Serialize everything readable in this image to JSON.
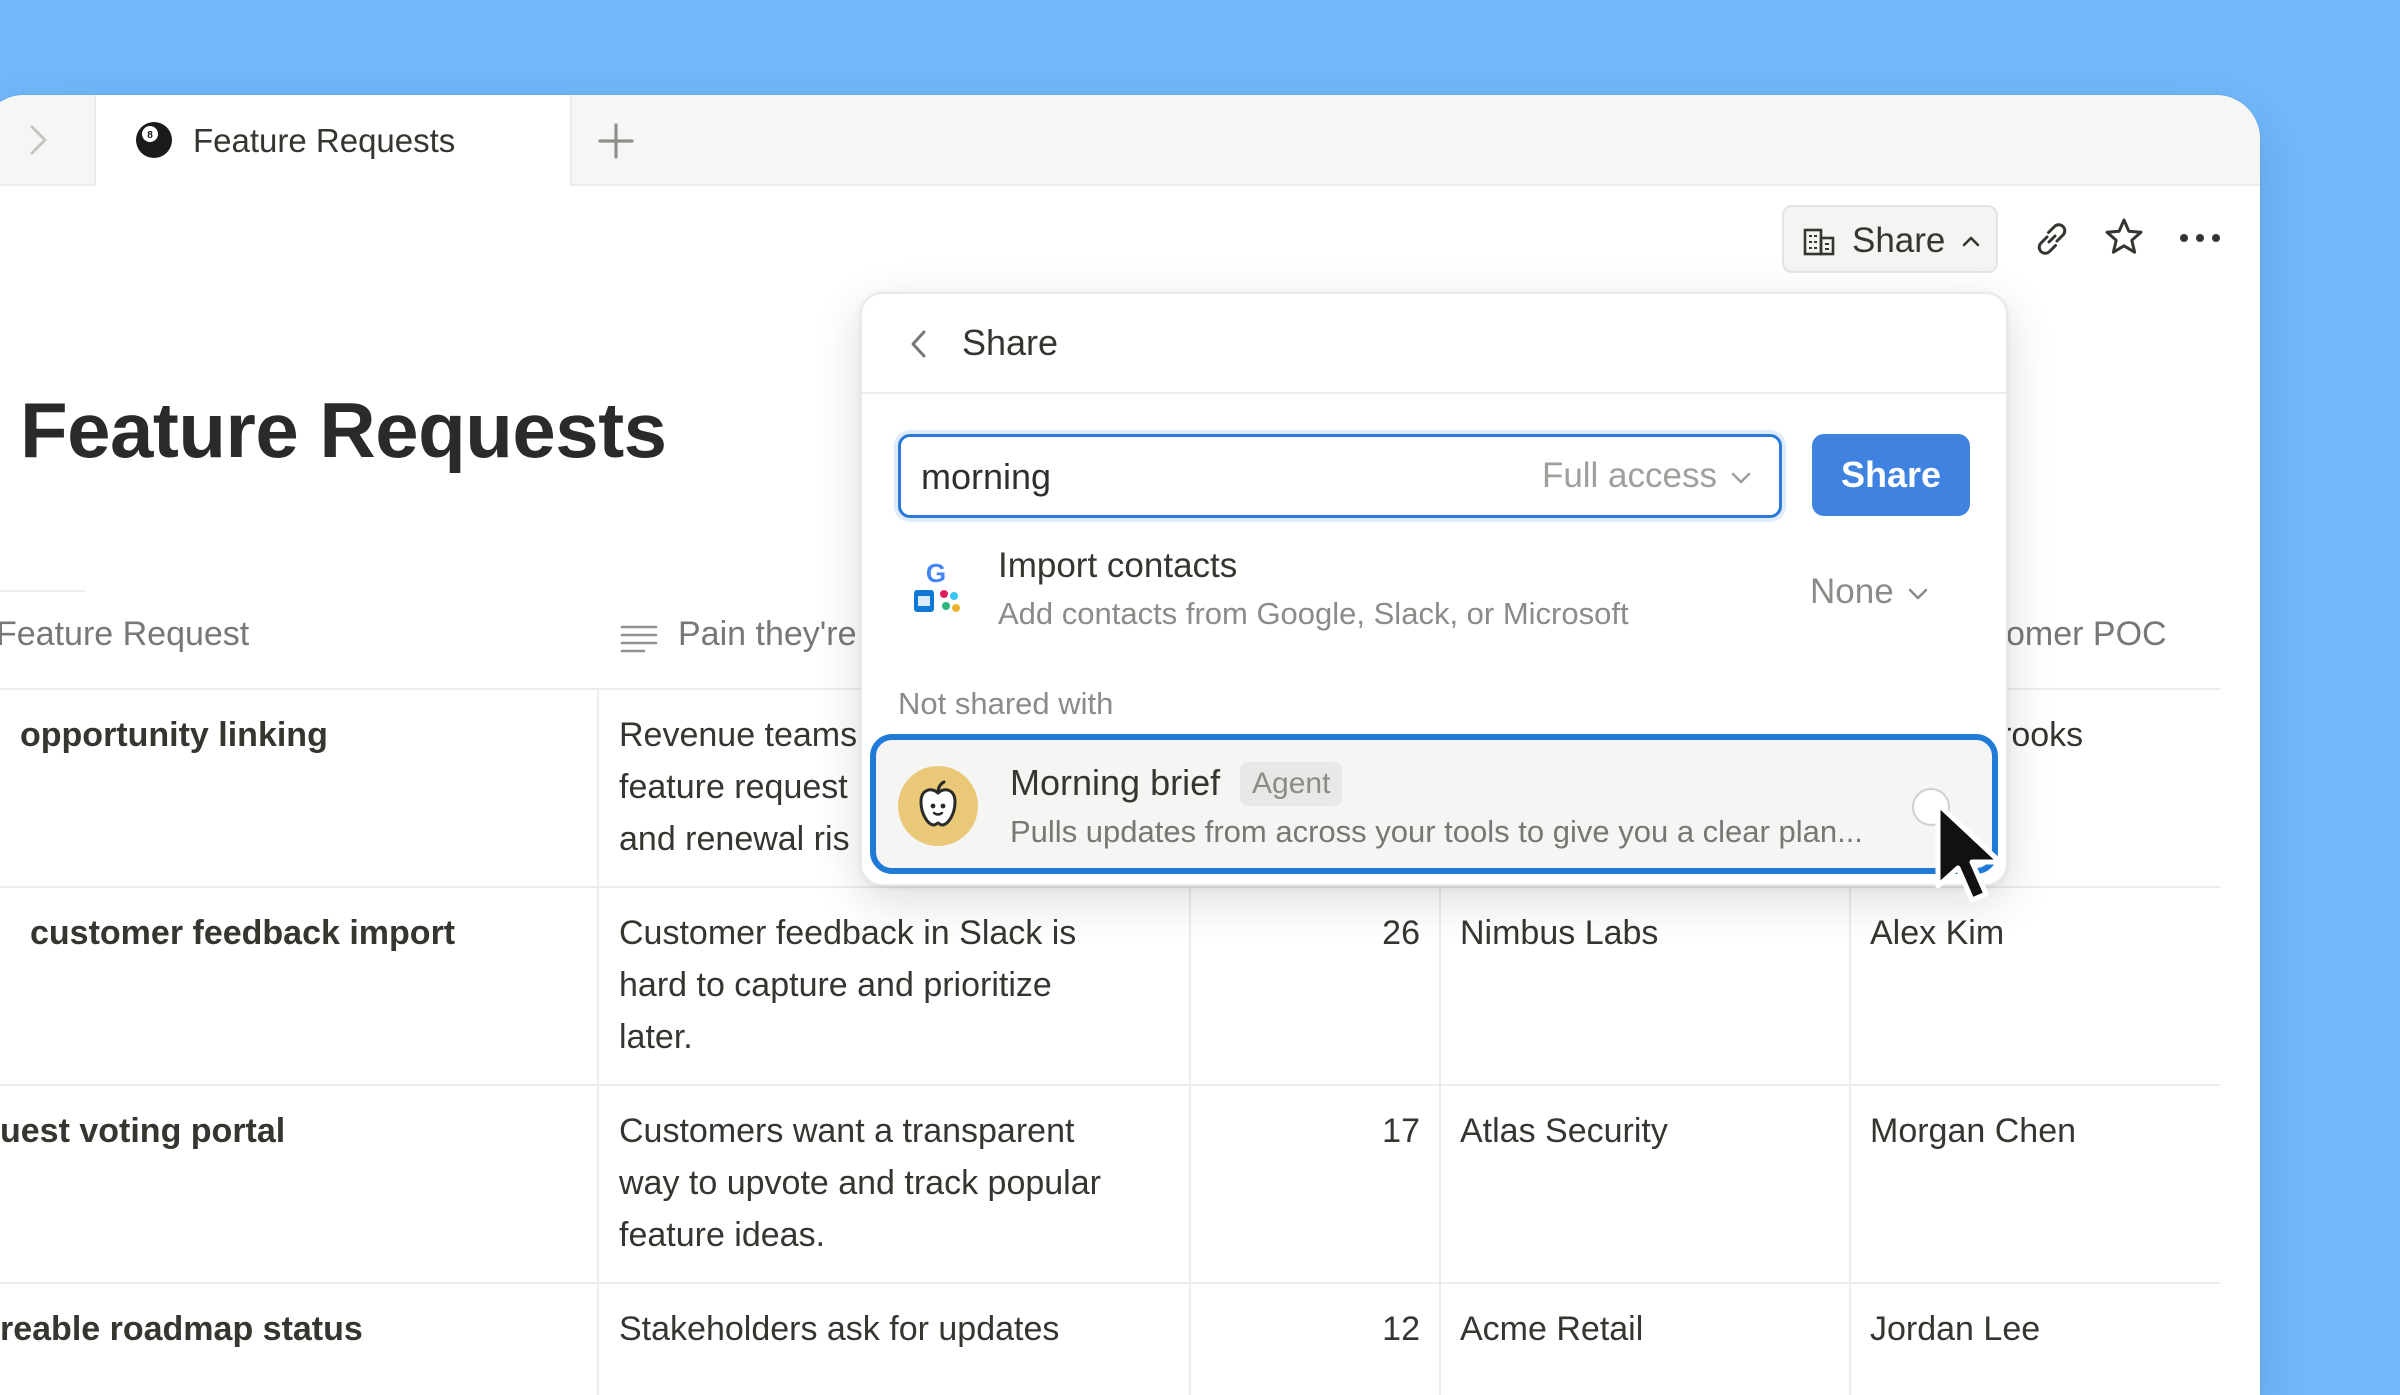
{
  "tab": {
    "title": "Feature Requests"
  },
  "toolbar": {
    "share_label": "Share"
  },
  "page": {
    "title": "Feature Requests"
  },
  "table": {
    "columns": [
      "Feature Request",
      "Pain they're",
      "omer POC"
    ],
    "rows": [
      {
        "feature": "opportunity linking",
        "pain": [
          "Revenue teams",
          "feature request",
          "and renewal ris"
        ],
        "count": "",
        "company": "",
        "poc": "rooks"
      },
      {
        "feature": " customer feedback import",
        "pain": [
          "Customer feedback in Slack is",
          "hard to capture and prioritize",
          "later."
        ],
        "count": "26",
        "company": "Nimbus Labs",
        "poc": "Alex Kim"
      },
      {
        "feature": "uest voting portal",
        "pain": [
          "Customers want a transparent",
          "way to upvote and track popular",
          "feature ideas."
        ],
        "count": "17",
        "company": "Atlas Security",
        "poc": "Morgan Chen"
      },
      {
        "feature": "reable roadmap status",
        "pain": [
          "Stakeholders ask for updates"
        ],
        "count": "12",
        "company": "Acme Retail",
        "poc": "Jordan Lee"
      }
    ]
  },
  "popup": {
    "title": "Share",
    "invite_value": "morning",
    "access_level": "Full access",
    "share_button": "Share",
    "import": {
      "title": "Import contacts",
      "subtitle": "Add contacts from Google, Slack, or Microsoft",
      "level": "None"
    },
    "section_label": "Not shared with",
    "agent": {
      "name": "Morning brief",
      "badge": "Agent",
      "description": "Pulls updates from across your tools to give you a clear plan..."
    }
  },
  "colors": {
    "background": "#72b9fb",
    "accent": "#3f82e0",
    "focus_ring": "#1f7ad8",
    "agent_avatar": "#e9c877"
  },
  "icons": [
    "chevron-right-icon",
    "eight-ball-icon",
    "plus-icon",
    "building-icon",
    "chevron-up-icon",
    "link-icon",
    "star-icon",
    "more-icon",
    "chevron-left-icon",
    "chevron-down-icon",
    "text-property-icon",
    "google-slack-microsoft-icon",
    "apple-icon",
    "mouse-pointer-icon"
  ]
}
